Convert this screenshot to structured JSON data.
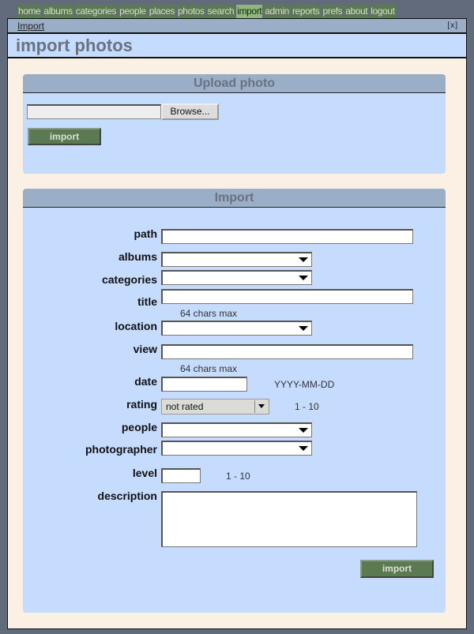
{
  "nav": [
    {
      "label": "home"
    },
    {
      "label": "albums"
    },
    {
      "label": "categories"
    },
    {
      "label": "people"
    },
    {
      "label": "places"
    },
    {
      "label": "photos"
    },
    {
      "label": "search"
    },
    {
      "label": "import",
      "active": true
    },
    {
      "label": "admin"
    },
    {
      "label": "reports"
    },
    {
      "label": "prefs"
    },
    {
      "label": "about"
    },
    {
      "label": "logout"
    }
  ],
  "window": {
    "title": "Import",
    "close": "[x]",
    "heading": "import photos"
  },
  "upload": {
    "title": "Upload photo",
    "browse": "Browse...",
    "import": "import"
  },
  "import": {
    "title": "Import",
    "labels": {
      "path": "path",
      "albums": "albums",
      "categories": "categories",
      "title": "title",
      "location": "location",
      "view": "view",
      "date": "date",
      "rating": "rating",
      "people": "people",
      "photographer": "photographer",
      "level": "level",
      "description": "description"
    },
    "hints": {
      "title": "64 chars max",
      "view": "64 chars max",
      "date": "YYYY-MM-DD",
      "rating": "1 - 10",
      "level": "1 - 10"
    },
    "rating_value": "not rated",
    "submit": "import"
  }
}
